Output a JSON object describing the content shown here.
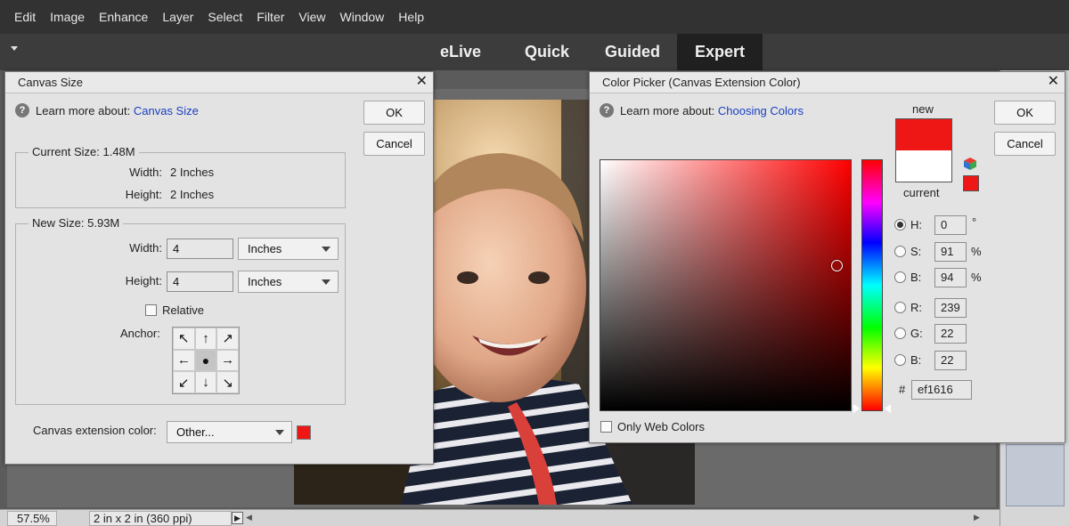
{
  "menubar": {
    "items": [
      "Edit",
      "Image",
      "Enhance",
      "Layer",
      "Select",
      "Filter",
      "View",
      "Window",
      "Help"
    ]
  },
  "modes": {
    "elive": "eLive",
    "quick": "Quick",
    "guided": "Guided",
    "expert": "Expert",
    "active": "Expert"
  },
  "status": {
    "zoom": "57.5%",
    "doc_info": "2 in x 2 in (360 ppi)"
  },
  "canvas_dialog": {
    "title": "Canvas Size",
    "learn_prefix": "Learn more about:",
    "learn_link": "Canvas Size",
    "ok": "OK",
    "cancel": "Cancel",
    "current_size_label": "Current Size: 1.48M",
    "current_width_label": "Width:",
    "current_width_value": "2 Inches",
    "current_height_label": "Height:",
    "current_height_value": "2 Inches",
    "new_size_label": "New Size: 5.93M",
    "width_label": "Width:",
    "width_value": "4",
    "width_unit": "Inches",
    "height_label": "Height:",
    "height_value": "4",
    "height_unit": "Inches",
    "relative_label": "Relative",
    "relative_checked": false,
    "anchor_label": "Anchor:",
    "anchor_arrows": [
      "↖",
      "↑",
      "↗",
      "←",
      "●",
      "→",
      "↙",
      "↓",
      "↘"
    ],
    "extension_color_label": "Canvas extension color:",
    "extension_color_value": "Other...",
    "extension_color_hex": "#ef1616"
  },
  "picker_dialog": {
    "title": "Color Picker (Canvas Extension Color)",
    "learn_prefix": "Learn more about:",
    "learn_link": "Choosing Colors",
    "ok": "OK",
    "cancel": "Cancel",
    "new_label": "new",
    "current_label": "current",
    "new_color": "#ef1616",
    "current_color": "#ffffff",
    "h_label": "H:",
    "h_value": "0",
    "h_unit": "°",
    "s_label": "S:",
    "s_value": "91",
    "s_unit": "%",
    "b_label": "B:",
    "b_value": "94",
    "b_unit": "%",
    "r_label": "R:",
    "r_value": "239",
    "g_label": "G:",
    "g_value": "22",
    "bb_label": "B:",
    "bb_value": "22",
    "hex_label": "#",
    "hex_value": "ef1616",
    "selected_mode": "H",
    "web_colors_label": "Only Web Colors",
    "web_colors_checked": false
  },
  "icons": {
    "help": "help-icon",
    "close": "close-icon",
    "cube": "color-cube-icon",
    "caret": "chevron-down-icon"
  }
}
